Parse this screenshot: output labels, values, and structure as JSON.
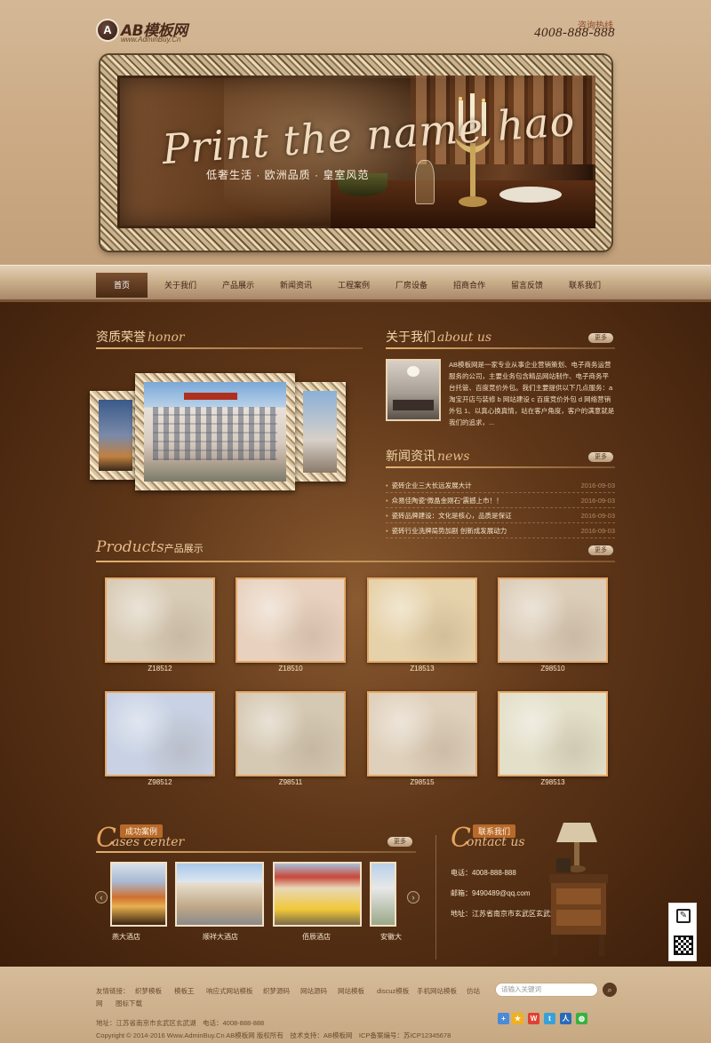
{
  "header": {
    "logo_mark": "A",
    "logo_text": "AB模板网",
    "logo_sub": "www.AdminBuy.Cn",
    "hotline_label": "咨询热线",
    "hotline_number": "4008-888-888"
  },
  "banner": {
    "script_text": "Print the name hao",
    "slogan": "低奢生活 · 欧洲品质 · 皇室风范"
  },
  "nav": {
    "items": [
      "首页",
      "关于我们",
      "产品展示",
      "新闻资讯",
      "工程案例",
      "厂房设备",
      "招商合作",
      "留言反馈",
      "联系我们"
    ],
    "active_index": 0
  },
  "sections": {
    "honor_title": "资质荣誉",
    "honor_script": "honor",
    "about_title": "关于我们",
    "about_script": "about us",
    "about_more": "更多",
    "about_text": "AB模板网是一家专业从事企业营销策划、电子商务运营服务的公司，主要业务包含精品网站制作、电子商务平台托管、百度竞价外包。我们主要提供以下几点服务：a 淘宝开店与装修 b 网站建设 c 百度竞价外包 d 网络营销外包 1、以真心换真情，站在客户角度，客户的满意就是我们的追求，...",
    "news_title": "新闻资讯",
    "news_script": "news",
    "news_more": "更多",
    "news": [
      {
        "title": "瓷砖企业三大长远发展大计",
        "date": "2016-09-03"
      },
      {
        "title": "众易佳陶瓷“微晶金刚石”震撼上市！！",
        "date": "2016-09-03"
      },
      {
        "title": "瓷砖品牌建设：文化是核心，品质是保证",
        "date": "2016-09-03"
      },
      {
        "title": "瓷砖行业洗牌局势加剧 创新成发展动力",
        "date": "2016-09-03"
      }
    ],
    "products_script": "Products",
    "products_title": "产品展示",
    "products_more": "更多",
    "products": [
      {
        "code": "Z18512",
        "color": "#d9ccb6"
      },
      {
        "code": "Z18510",
        "color": "#e8d2bf"
      },
      {
        "code": "Z18513",
        "color": "#e6d2aa"
      },
      {
        "code": "Z98510",
        "color": "#dccdb8"
      },
      {
        "code": "Z98512",
        "color": "#c8d2e4"
      },
      {
        "code": "Z98511",
        "color": "#d6c9b3"
      },
      {
        "code": "Z98515",
        "color": "#dfd0bb"
      },
      {
        "code": "Z98513",
        "color": "#e3dfc9"
      }
    ],
    "cases_badge": "成功案例",
    "cases_script": "ases center",
    "cases_script_initial": "C",
    "cases_more": "更多",
    "cases": [
      {
        "label": "燕大酒店"
      },
      {
        "label": "顺祥大酒店"
      },
      {
        "label": "佰辰酒店"
      },
      {
        "label": "安徽大"
      }
    ],
    "contact_badge": "联系我们",
    "contact_script": "ontact us",
    "contact_script_initial": "C",
    "contact_phone": "电话：4008-888-888",
    "contact_email": "邮箱：9490489@qq.com",
    "contact_address": "地址：江苏省南京市玄武区玄武湖"
  },
  "footer": {
    "links_label": "友情链接：",
    "links": [
      "织梦模板",
      "模板王",
      "响应式网站模板",
      "织梦源码",
      "网站源码",
      "网站模板",
      "discuz模板",
      "手机网站模板",
      "仿站",
      "网",
      "图标下载"
    ],
    "address": "地址：江苏省南京市玄武区玄武湖　电话：4008-888-888",
    "copyright": "Copyright © 2014-2016 Www.AdminBuy.Cn AB模板网 版权所有　技术支持：AB模板网　ICP备案编号：苏ICP12345678",
    "search_placeholder": "请输入关键词",
    "search_icon": "search-icon",
    "share_icons": [
      "share-plus-icon",
      "qzone-icon",
      "weibo-icon",
      "tencent-weibo-icon",
      "renren-icon",
      "wechat-icon"
    ]
  },
  "side_widget": {
    "icons": [
      "edit-icon",
      "qrcode-icon"
    ]
  }
}
